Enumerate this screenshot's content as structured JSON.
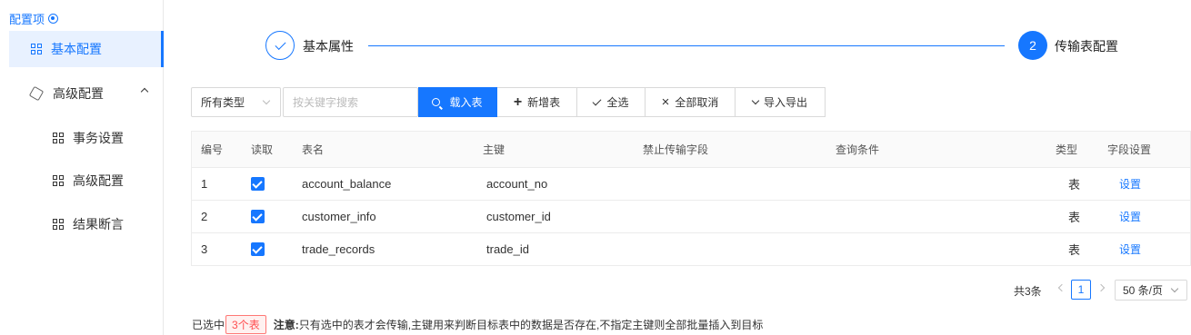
{
  "sidebar": {
    "title": "配置项",
    "items": [
      {
        "label": "基本配置"
      },
      {
        "label": "高级配置"
      },
      {
        "label": "事务设置"
      },
      {
        "label": "高级配置"
      },
      {
        "label": "结果断言"
      }
    ]
  },
  "steps": [
    {
      "label": "基本属性",
      "status": "done"
    },
    {
      "number": "2",
      "label": "传输表配置",
      "status": "current"
    }
  ],
  "toolbar": {
    "type_select": "所有类型",
    "search_placeholder": "按关键字搜索",
    "load_label": "载入表",
    "add_label": "新增表",
    "select_all_label": "全选",
    "deselect_all_label": "全部取消",
    "import_export_label": "导入导出"
  },
  "table": {
    "headers": [
      "编号",
      "读取",
      "表名",
      "主键",
      "禁止传输字段",
      "查询条件",
      "类型",
      "字段设置"
    ],
    "rows": [
      {
        "no": "1",
        "name": "account_balance",
        "pk": "account_no",
        "banned": "",
        "query": "",
        "type": "表",
        "action": "设置"
      },
      {
        "no": "2",
        "name": "customer_info",
        "pk": "customer_id",
        "banned": "",
        "query": "",
        "type": "表",
        "action": "设置"
      },
      {
        "no": "3",
        "name": "trade_records",
        "pk": "trade_id",
        "banned": "",
        "query": "",
        "type": "表",
        "action": "设置"
      }
    ]
  },
  "pagination": {
    "total": "共3条",
    "current": "1",
    "page_size": "50 条/页"
  },
  "footer": {
    "selected_prefix": "已选中",
    "selected_count": "3个表",
    "note_label": "注意:",
    "note_text": "只有选中的表才会传输,主键用来判断目标表中的数据是否存在,不指定主键则全部批量插入到目标"
  },
  "colors": {
    "accent": "#1677ff",
    "danger": "#ff4d4f"
  }
}
